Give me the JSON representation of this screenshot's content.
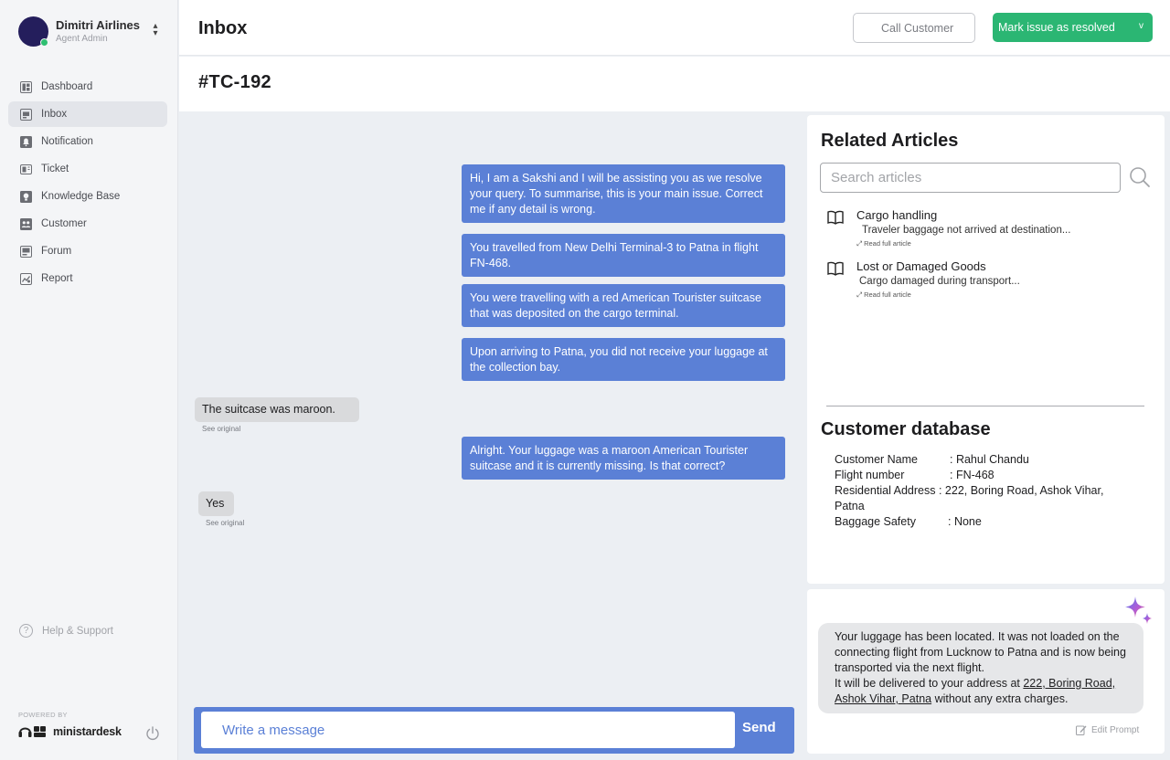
{
  "org": {
    "name": "Dimitri Airlines",
    "role": "Agent Admin"
  },
  "sidebar": {
    "items": [
      {
        "label": "Dashboard"
      },
      {
        "label": "Inbox"
      },
      {
        "label": "Notification"
      },
      {
        "label": "Ticket"
      },
      {
        "label": "Knowledge Base"
      },
      {
        "label": "Customer"
      },
      {
        "label": "Forum"
      },
      {
        "label": "Report"
      }
    ],
    "help": "Help & Support",
    "powered_by": "POWERED BY",
    "brand": "ministardesk"
  },
  "header": {
    "title": "Inbox",
    "call_label": "Call Customer",
    "resolve_label": "Mark issue as resolved",
    "resolve_caret": "v"
  },
  "ticket": {
    "id": "#TC-192"
  },
  "chat": {
    "agent_messages": [
      "Hi, I am a Sakshi and I will be assisting you as we resolve your query. To summarise, this is your main issue. Correct me if any detail is wrong.",
      "You travelled from New Delhi Terminal-3 to Patna in flight FN-468.",
      "You were travelling with a red American Tourister suitcase that was deposited on the cargo terminal.",
      "Upon arriving to Patna, you did not receive your luggage at the collection bay.",
      "Alright. Your luggage was a maroon American Tourister suitcase and it is currently missing. Is that correct?"
    ],
    "user_messages": [
      "The suitcase was maroon.",
      "Yes"
    ],
    "see_original": "See original",
    "placeholder": "Write a message",
    "send_label": "Send"
  },
  "articles": {
    "title": "Related Articles",
    "search_placeholder": "Search articles",
    "items": [
      {
        "title": "Cargo handling",
        "summary": "Traveler baggage not arrived at destination...",
        "link": "Read full article"
      },
      {
        "title": "Lost or Damaged Goods",
        "summary": "Cargo damaged during transport...",
        "link": "Read full article"
      }
    ]
  },
  "customer": {
    "title": "Customer database",
    "fields": [
      {
        "key": "Customer Name",
        "value": ": Rahul Chandu"
      },
      {
        "key": "Flight number",
        "value": ": FN-468"
      },
      {
        "key": "Residential Address",
        "value": ": 222, Boring Road, Ashok Vihar, Patna"
      },
      {
        "key": "Baggage Safety",
        "value": ": None"
      }
    ]
  },
  "ai": {
    "line1": "Your luggage has been located. It was not loaded on the connecting flight from Lucknow to Patna and is now being transported via the next flight.",
    "line2_pre": "It will be delivered to your address at ",
    "line2_addr": "222, Boring Road, Ashok Vihar, Patna",
    "line2_post": " without any extra charges.",
    "edit_label": "Edit Prompt"
  },
  "colors": {
    "accent_blue": "#5b80d6",
    "resolve_green": "#2bb673",
    "status_online": "#2fbf71"
  }
}
